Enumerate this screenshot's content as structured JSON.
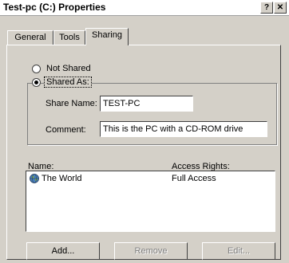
{
  "window": {
    "title": "Test-pc (C:) Properties",
    "help_button": "?",
    "close_button": "✕"
  },
  "tabs": [
    {
      "label": "General",
      "active": false
    },
    {
      "label": "Tools",
      "active": false
    },
    {
      "label": "Sharing",
      "active": true
    }
  ],
  "sharing": {
    "not_shared_label": "Not Shared",
    "shared_as_label": "Shared As:",
    "selected": "shared_as",
    "share_name_label": "Share Name:",
    "share_name_value": "TEST-PC",
    "comment_label": "Comment:",
    "comment_value": "This is the PC with a CD-ROM drive"
  },
  "permissions": {
    "col_name": "Name:",
    "col_access": "Access Rights:",
    "rows": [
      {
        "name": "The World",
        "access": "Full Access",
        "icon": "globe-icon"
      }
    ]
  },
  "buttons": {
    "add": "Add...",
    "remove": "Remove",
    "edit": "Edit..."
  }
}
